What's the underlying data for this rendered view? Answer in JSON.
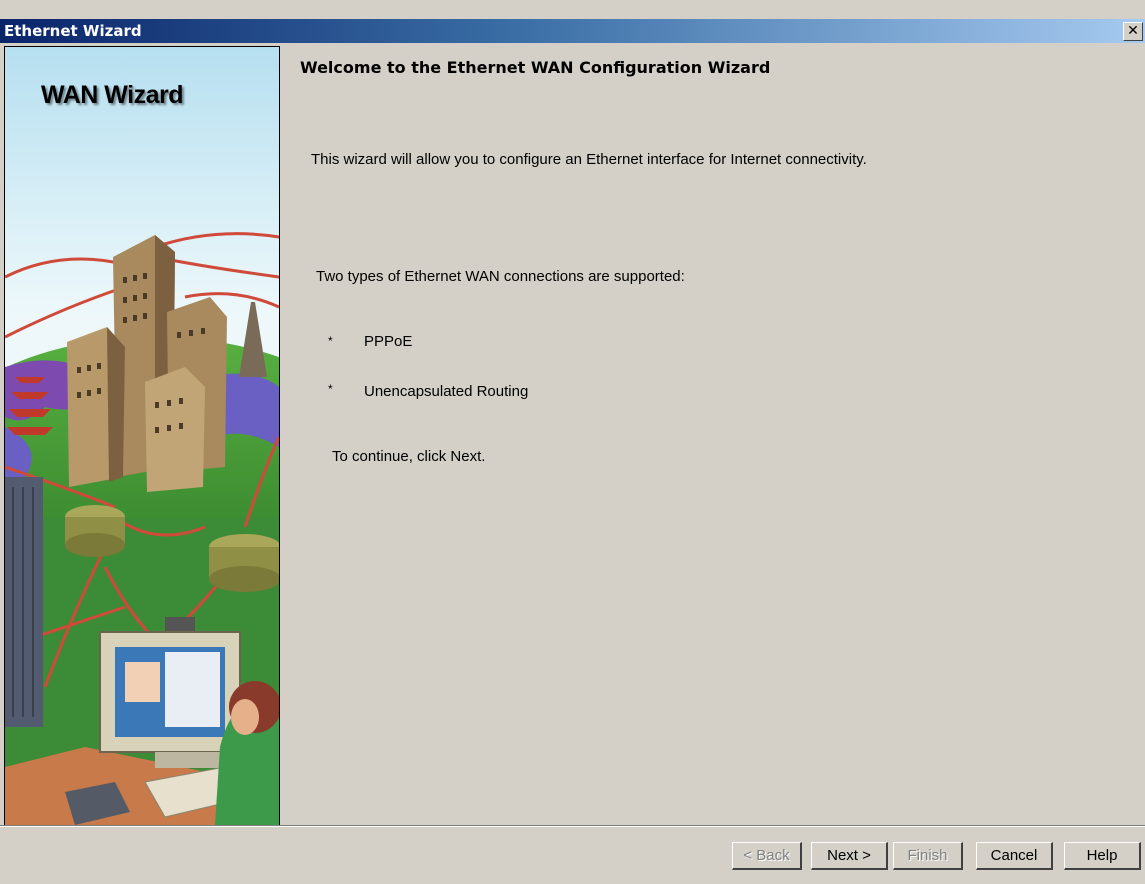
{
  "window": {
    "title": "Ethernet Wizard",
    "close_label": "✕"
  },
  "side_panel": {
    "title": "WAN Wizard"
  },
  "content": {
    "heading": "Welcome to the Ethernet WAN Configuration Wizard",
    "intro": "This wizard will allow you to configure an Ethernet interface for Internet connectivity.",
    "types_intro": "Two types of Ethernet WAN connections are supported:",
    "bullet_mark": "*",
    "types": [
      "PPPoE",
      "Unencapsulated Routing"
    ],
    "continue_text": "To continue, click Next."
  },
  "buttons": {
    "back": "< Back",
    "next": "Next >",
    "finish": "Finish",
    "cancel": "Cancel",
    "help": "Help"
  }
}
